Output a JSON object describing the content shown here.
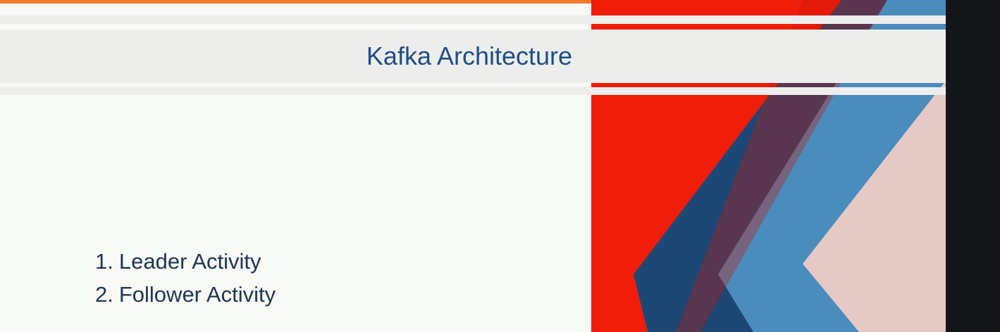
{
  "slide": {
    "title": "Kafka Architecture",
    "items": [
      {
        "number": "1.",
        "text": "Leader Activity"
      },
      {
        "number": "2.",
        "text": "Follower Activity"
      }
    ]
  },
  "colors": {
    "accent_orange": "#f07a2a",
    "title_blue": "#1f4f85",
    "body_text": "#1e3552",
    "slide_background": "#f8faf6",
    "stripe_gray": "#ededec",
    "panel_red": "#f01d0b",
    "panel_navy": "#1d4876",
    "panel_blue": "#4a8cbc",
    "panel_pink": "#e5c9c4",
    "outer_background": "#141619"
  },
  "decoration": {
    "right_pane_image": "layered-paper-chevron-graphic"
  }
}
